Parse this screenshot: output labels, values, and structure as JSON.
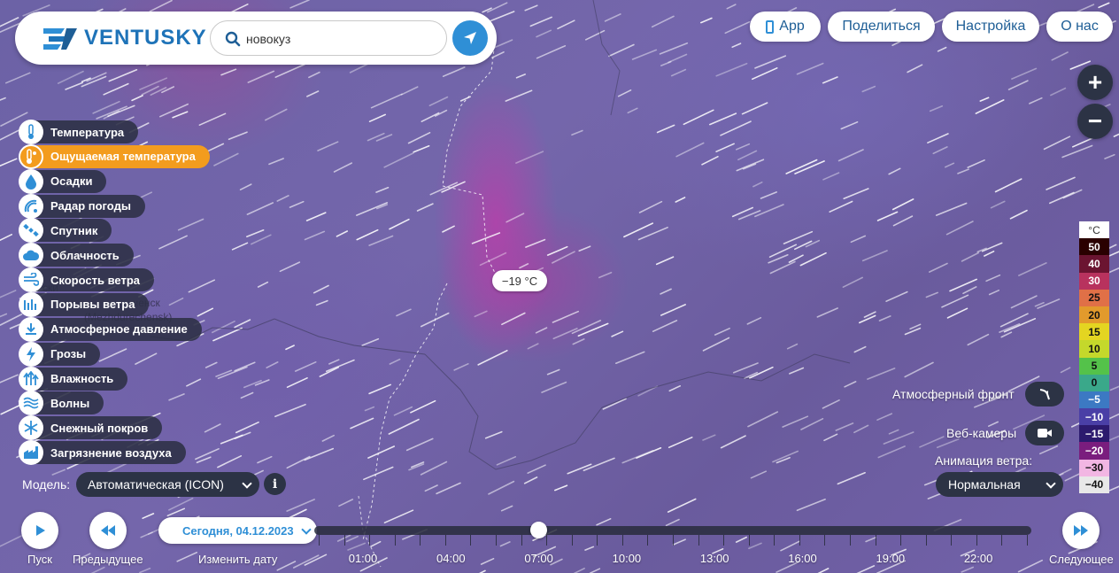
{
  "app": {
    "logo_text": "VENTUSKY"
  },
  "search": {
    "value": "новокуз"
  },
  "top_buttons": {
    "app": "App",
    "share": "Поделиться",
    "settings": "Настройка",
    "about": "О нас"
  },
  "zoom": {
    "in": "+",
    "out": "−"
  },
  "layers": [
    {
      "label": "Температура",
      "icon": "thermometer-icon",
      "active": false
    },
    {
      "label": "Ощущаемая температура",
      "icon": "feels-like-icon",
      "active": true
    },
    {
      "label": "Осадки",
      "icon": "raindrop-icon",
      "active": false
    },
    {
      "label": "Радар погоды",
      "icon": "radar-icon",
      "active": false
    },
    {
      "label": "Спутник",
      "icon": "satellite-icon",
      "active": false
    },
    {
      "label": "Облачность",
      "icon": "cloud-icon",
      "active": false
    },
    {
      "label": "Скорость ветра",
      "icon": "wind-icon",
      "active": false
    },
    {
      "label": "Порывы ветра",
      "icon": "gusts-icon",
      "active": false
    },
    {
      "label": "Атмосферное давление",
      "icon": "pressure-icon",
      "active": false
    },
    {
      "label": "Грозы",
      "icon": "lightning-icon",
      "active": false
    },
    {
      "label": "Влажность",
      "icon": "humidity-icon",
      "active": false
    },
    {
      "label": "Волны",
      "icon": "waves-icon",
      "active": false
    },
    {
      "label": "Снежный покров",
      "icon": "snowflake-icon",
      "active": false
    },
    {
      "label": "Загрязнение воздуха",
      "icon": "factory-icon",
      "active": false
    }
  ],
  "model": {
    "label": "Модель:",
    "value": "Автоматическая (ICON)",
    "info": "i"
  },
  "map": {
    "temperature_label": "−19 °C",
    "cities": [
      "ски",
      "ченск",
      "(Mezhdurechensk)"
    ]
  },
  "legend": {
    "unit": "°C",
    "values": [
      "50",
      "40",
      "30",
      "25",
      "20",
      "15",
      "10",
      "5",
      "0",
      "−5",
      "−10",
      "−15",
      "−20",
      "−30",
      "−40"
    ],
    "colors": [
      "#2a0000",
      "#6b1431",
      "#b8325e",
      "#e07047",
      "#e29a2c",
      "#e4d521",
      "#c4d82b",
      "#54c24a",
      "#3aa88a",
      "#3c79c3",
      "#4a3fa6",
      "#2c1a6e",
      "#7a1d7e",
      "#f2b6e3",
      "#e8e8e8"
    ],
    "text_colors": [
      "#fff",
      "#fff",
      "#fff",
      "#111",
      "#111",
      "#111",
      "#111",
      "#111",
      "#111",
      "#fff",
      "#fff",
      "#fff",
      "#fff",
      "#111",
      "#111"
    ]
  },
  "right_panel": {
    "front_label": "Атмосферный фронт",
    "webcams_label": "Веб-камеры",
    "wind_anim_label": "Анимация ветра:",
    "wind_anim_value": "Нормальная"
  },
  "timeline": {
    "play_label": "Пуск",
    "prev_label": "Предыдущее",
    "next_label": "Следующее",
    "date": "Сегодня, 04.12.2023",
    "change_date": "Изменить дату",
    "hours": [
      "01:00",
      "04:00",
      "07:00",
      "10:00",
      "13:00",
      "16:00",
      "19:00",
      "22:00"
    ],
    "current_hour": "07:00"
  },
  "colors": {
    "accent": "#2f8fd6",
    "active_layer": "#f39c1e",
    "dark_button": "#2c3345"
  }
}
